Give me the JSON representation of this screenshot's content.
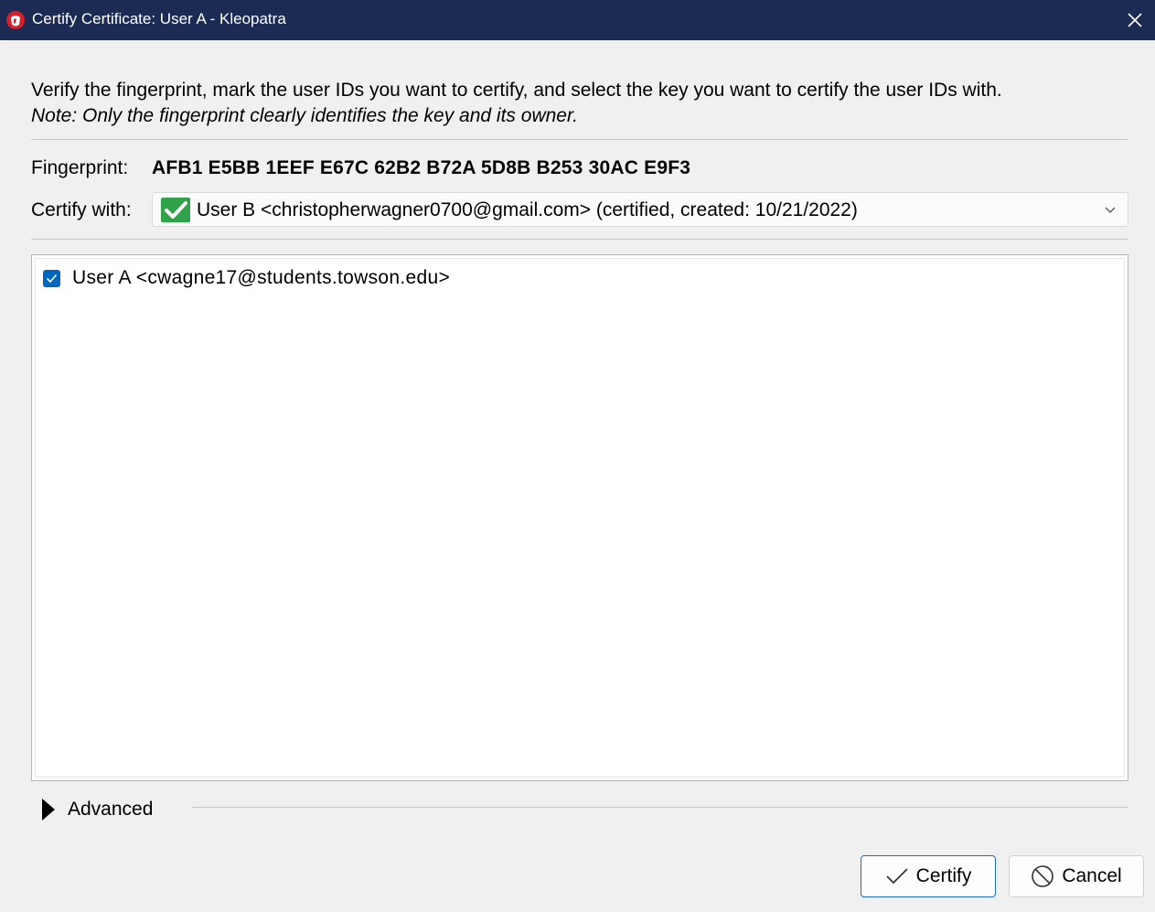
{
  "window": {
    "title": "Certify Certificate: User A - Kleopatra"
  },
  "dialog": {
    "instruction": "Verify the fingerprint, mark the user IDs you want to certify, and select the key you want to certify the user IDs with.",
    "note": "Note: Only the fingerprint clearly identifies the key and its owner.",
    "fingerprint_label": "Fingerprint:",
    "fingerprint_value": "AFB1 E5BB 1EEF E67C 62B2 B72A 5D8B B253 30AC E9F3",
    "certify_with_label": "Certify with:",
    "certify_with_value": "User B <christopherwagner0700@gmail.com> (certified, created: 10/21/2022)",
    "user_ids": [
      {
        "label": "User A <cwagne17@students.towson.edu>",
        "checked": true
      }
    ],
    "advanced_label": "Advanced",
    "certify_button": "Certify",
    "cancel_button": "Cancel"
  },
  "colors": {
    "titlebar": "#1c2b53",
    "checkbox": "#0067c0",
    "valid_check": "#2fa34a",
    "primary_border": "#1a6fc9"
  },
  "icons": {
    "app": "kleopatra-icon",
    "close": "close-icon",
    "valid": "valid-check-icon",
    "dropdown": "chevron-down-icon",
    "checkbox": "checkmark-icon",
    "advanced": "triangle-right-icon",
    "certify": "check-icon",
    "cancel": "cancel-icon"
  }
}
